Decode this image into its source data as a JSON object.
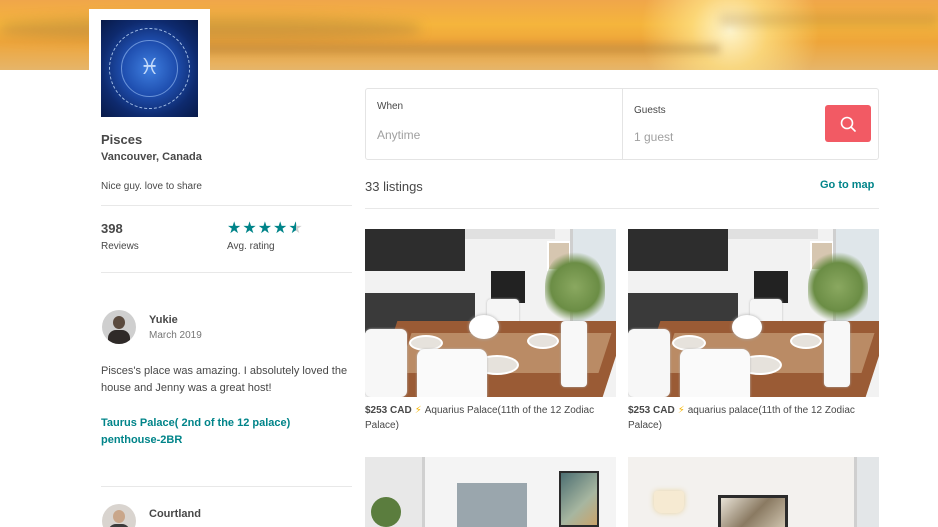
{
  "host": {
    "name": "Pisces",
    "location": "Vancouver, Canada",
    "bio": "Nice guy. love to share",
    "reviews_count": "398",
    "reviews_label": "Reviews",
    "rating_label": "Avg. rating",
    "rating": 4.5,
    "rating_stars": "★★★★",
    "rating_half_star": "★"
  },
  "reviews": [
    {
      "name": "Yukie",
      "date": "March 2019",
      "text": "Pisces's place was amazing. I absolutely loved the house and Jenny was a great host!",
      "listing_link": "Taurus Palace( 2nd of the 12 palace) penthouse-2BR"
    },
    {
      "name": "Courtland",
      "date": ""
    }
  ],
  "search": {
    "when_label": "When",
    "when_value": "Anytime",
    "guests_label": "Guests",
    "guests_value": "1 guest"
  },
  "listings_header": {
    "count_text": "33 listings",
    "map_link": "Go to map"
  },
  "listings": [
    {
      "price": "$253 CAD",
      "title": "Aquarius Palace(11th of the 12 Zodiac Palace)"
    },
    {
      "price": "$253 CAD",
      "title": "aquarius palace(11th of the 12 Zodiac Palace)"
    },
    {
      "price": "",
      "title": ""
    },
    {
      "price": "",
      "title": ""
    }
  ],
  "colors": {
    "accent_teal": "#008489",
    "search_button": "#F25A64",
    "star": "#008489",
    "bolt": "#F5B400"
  },
  "icons": {
    "search_button_icon": "search-icon",
    "price_bolt_icon": "lightning-bolt-icon",
    "avatar": "zodiac-wheel-image"
  }
}
